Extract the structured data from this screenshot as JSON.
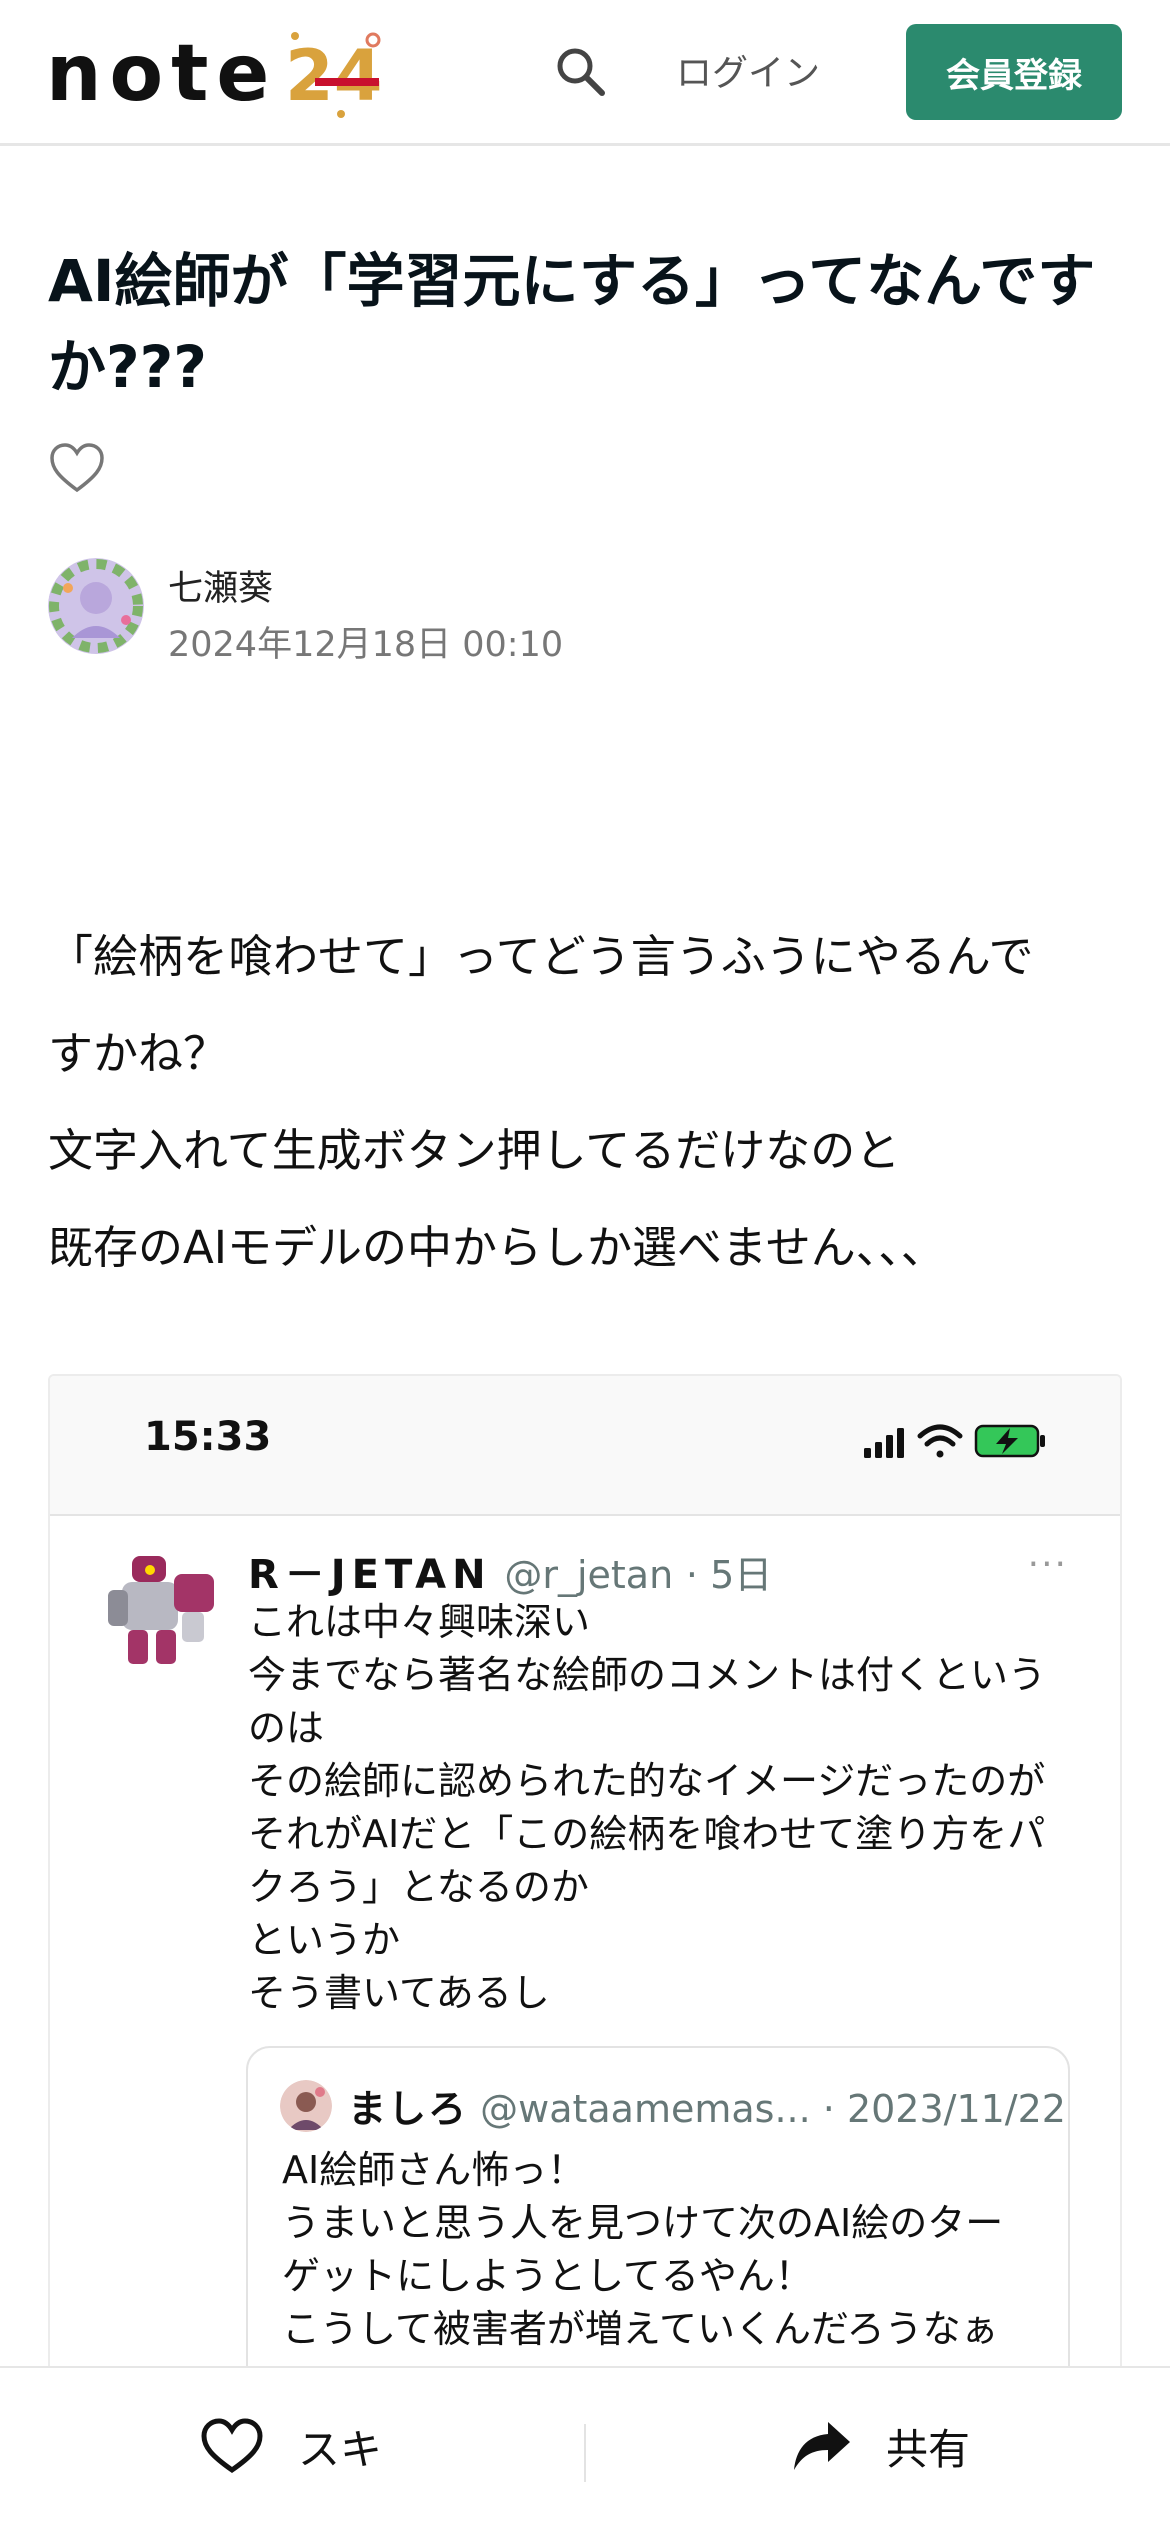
{
  "header": {
    "logo_text": "note",
    "logo_badge": "24",
    "search_icon": "search-icon",
    "login_label": "ログイン",
    "signup_label": "会員登録",
    "brand_color": "#2b8a6e"
  },
  "article": {
    "title": "AI絵師が「学習元にする」ってなんですか???",
    "like_icon": "heart-outline-icon",
    "author": {
      "name": "七瀬葵",
      "date": "2024年12月18日 00:10"
    },
    "paragraphs": [
      "「絵柄を喰わせて」ってどう言うふうにやるんで",
      "すかね？",
      "文字入れて生成ボタン押してるだけなのと",
      "既存のAIモデルの中からしか選べません、、、"
    ]
  },
  "embedded_image": {
    "phone_time": "15:33",
    "tweet": {
      "name": "R－JETAN",
      "handle": "@r_jetan",
      "age": "· 5日",
      "more": "···",
      "lines": [
        "これは中々興味深い",
        "今までなら著名な絵師のコメントは付くという",
        "のは",
        "その絵師に認められた的なイメージだったのが",
        "それがAIだと「この絵柄を喰わせて塗り方をパ",
        "クろう」となるのか",
        "というか",
        "そう書いてあるし"
      ],
      "quote": {
        "name": "ましろ",
        "handle": "@wataamemas...",
        "date": "· 2023/11/22",
        "lines": [
          "AI絵師さん怖っ！",
          "うまいと思う人を見つけて次のAI絵のター",
          "ゲットにしようとしてるやん！",
          "こうして被害者が増えていくんだろうなぁ"
        ]
      }
    }
  },
  "bottom_bar": {
    "suki_label": "スキ",
    "share_label": "共有"
  }
}
